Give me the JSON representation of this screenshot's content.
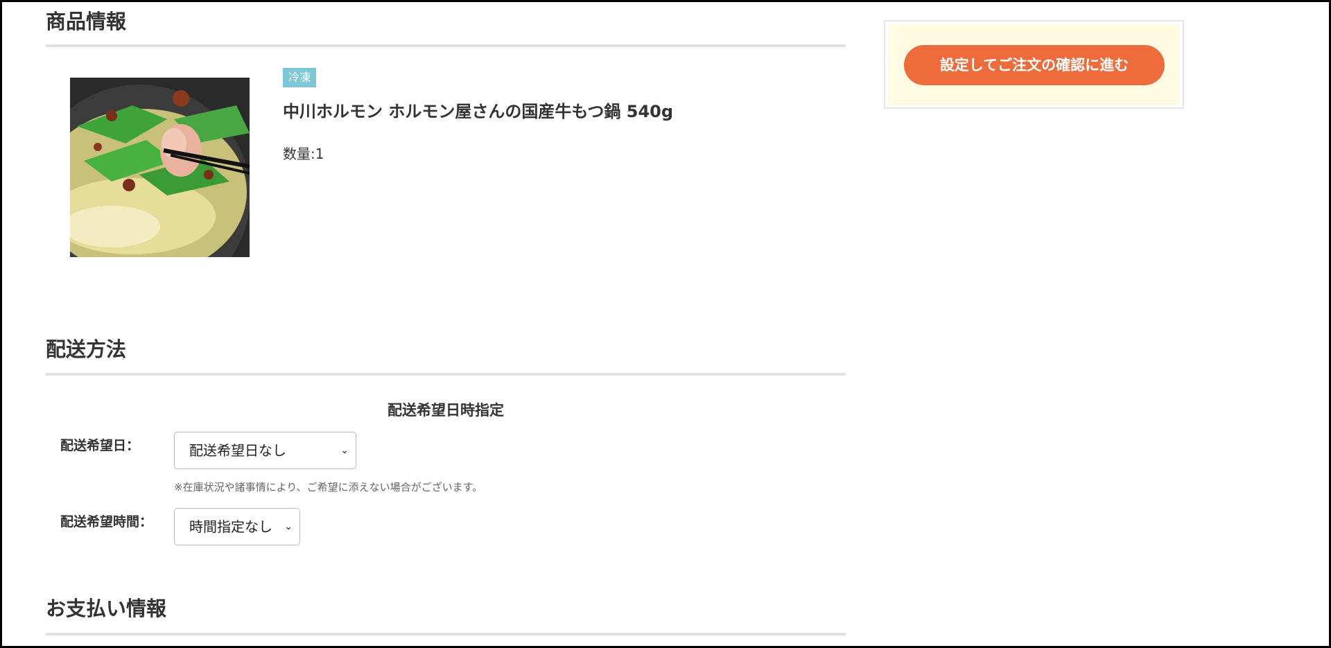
{
  "sections": {
    "product_title": "商品情報",
    "delivery_title": "配送方法",
    "payment_title": "お支払い情報"
  },
  "product": {
    "badge": "冷凍",
    "name": "中川ホルモン ホルモン屋さんの国産牛もつ鍋 540g",
    "quantity": "数量:1",
    "image_icon": "motsu-nabe-photo"
  },
  "delivery": {
    "subtitle": "配送希望日時指定",
    "date_label": "配送希望日：",
    "date_value": "配送希望日なし",
    "note": "※在庫状況や諸事情により、ご希望に添えない場合がございます。",
    "time_label": "配送希望時間：",
    "time_value": "時間指定なし"
  },
  "sidebar": {
    "proceed_button": "設定してご注文の確認に進む"
  },
  "colors": {
    "accent": "#ee6c3c",
    "badge": "#7cc8d6",
    "sidebar_bg": "#fffbe3",
    "rule": "#e2e2e6"
  }
}
